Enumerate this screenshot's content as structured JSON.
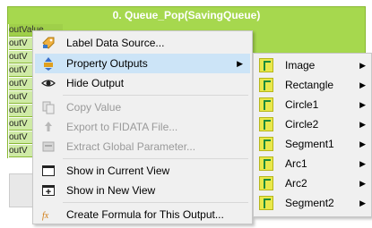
{
  "node": {
    "title": "0. Queue_Pop(SavingQueue)",
    "outputs": [
      "outValue",
      "outV",
      "outV",
      "outV",
      "outV",
      "outV",
      "outV",
      "outV",
      "outV",
      "outV"
    ]
  },
  "context_menu": {
    "items": [
      {
        "label": "Label Data Source...",
        "icon": "label-icon",
        "disabled": false
      },
      {
        "label": "Property Outputs",
        "icon": "property-outputs-icon",
        "disabled": false,
        "submenu": true,
        "highlighted": true
      },
      {
        "label": "Hide Output",
        "icon": "eye-icon",
        "disabled": false
      },
      {
        "label": "Copy Value",
        "icon": "copy-icon",
        "disabled": true
      },
      {
        "label": "Export to FIDATA File...",
        "icon": "export-icon",
        "disabled": true
      },
      {
        "label": "Extract Global Parameter...",
        "icon": "extract-icon",
        "disabled": true
      },
      {
        "label": "Show in Current View",
        "icon": "window-icon",
        "disabled": false
      },
      {
        "label": "Show in New View",
        "icon": "new-window-icon",
        "disabled": false
      },
      {
        "label": "Create Formula for This Output...",
        "icon": "formula-icon",
        "disabled": false
      }
    ]
  },
  "submenu": {
    "items": [
      "Image",
      "Rectangle",
      "Circle1",
      "Circle2",
      "Segment1",
      "Arc1",
      "Arc2",
      "Segment2"
    ]
  },
  "colors": {
    "node_green": "#a6d84e",
    "menu_bg": "#f0f0f0",
    "highlight": "#cce4f7"
  }
}
